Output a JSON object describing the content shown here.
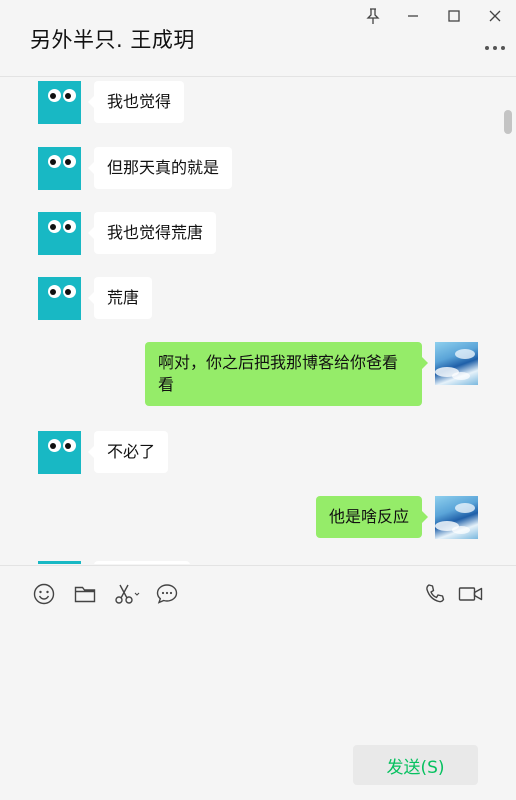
{
  "header": {
    "title": "另外半只. 王成玥"
  },
  "messages": [
    {
      "from": "other",
      "text": "我也觉得"
    },
    {
      "from": "other",
      "text": "但那天真的就是"
    },
    {
      "from": "other",
      "text": "我也觉得荒唐"
    },
    {
      "from": "other",
      "text": "荒唐"
    },
    {
      "from": "me",
      "text": "啊对，你之后把我那博客给你爸看看"
    },
    {
      "from": "other",
      "text": "不必了"
    },
    {
      "from": "me",
      "text": "他是啥反应"
    }
  ],
  "toolbar": {
    "icons": [
      "emoji-icon",
      "folder-icon",
      "scissors-icon",
      "chat-bubble-icon",
      "phone-icon",
      "video-icon"
    ]
  },
  "send_button": {
    "label": "发送(S)"
  },
  "colors": {
    "accent": "#07c160",
    "outgoing_bubble": "#95ec69",
    "avatar_teal": "#18b8c4"
  }
}
